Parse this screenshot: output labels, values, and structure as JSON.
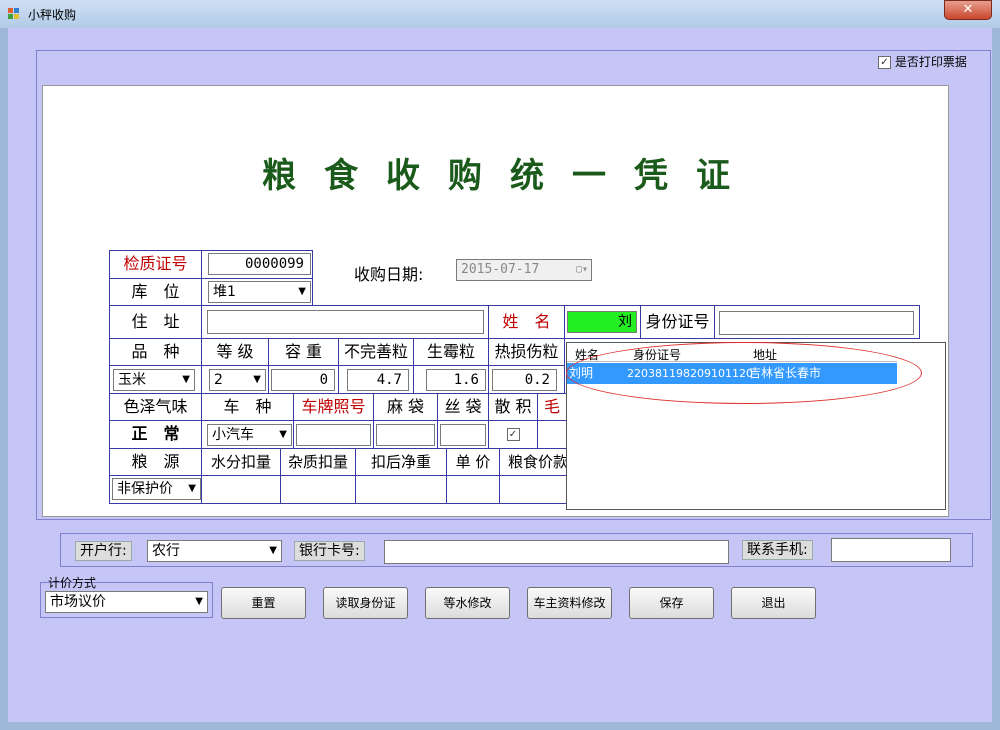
{
  "window": {
    "title": "小秤收购",
    "close_glyph": "✕"
  },
  "print_receipt": {
    "label": "是否打印票据",
    "checked": true
  },
  "voucher": {
    "title": "粮食收购统一凭证"
  },
  "form": {
    "inspection_no_label": "检质证号",
    "inspection_no": "0000099",
    "purchase_date_label": "收购日期:",
    "purchase_date": "2015-07-17",
    "warehouse_label": "库　位",
    "warehouse": "堆1",
    "address_label": "住　址",
    "address": "",
    "name_label": "姓　名",
    "name": "刘",
    "id_label": "身份证号",
    "id_no": "",
    "variety_label": "品　种",
    "variety": "玉米",
    "grade_label": "等 级",
    "grade": "2",
    "bulk_density_label": "容 重",
    "bulk_density": "0",
    "imperfect_label": "不完善粒",
    "imperfect": "4.7",
    "mold_label": "生霉粒",
    "mold": "1.6",
    "heat_damage_label": "热损伤粒",
    "heat_damage": "0.2",
    "color_smell_label": "色泽气味",
    "color_smell": "正　常",
    "vehicle_type_label": "车　种",
    "vehicle_type": "小汽车",
    "plate_label": "车牌照号",
    "sack_label": "麻 袋",
    "silk_bag_label": "丝 袋",
    "bulk_label": "散 积",
    "bulk_checked": true,
    "gross_label": "毛",
    "grain_source_label": "粮　源",
    "grain_source": "非保护价",
    "moisture_label": "水分扣量",
    "impurity_label": "杂质扣量",
    "net_weight_label": "扣后净重",
    "unit_price_label": "单 价",
    "grain_amount_label": "粮食价款"
  },
  "popup": {
    "columns": [
      "姓名",
      "身份证号",
      "地址"
    ],
    "rows": [
      {
        "name": "刘明",
        "id": "220381198209101120",
        "address": "吉林省长春市"
      }
    ]
  },
  "bank": {
    "bank_label": "开户行:",
    "bank": "农行",
    "card_label": "银行卡号:",
    "card": "",
    "phone_label": "联系手机:",
    "phone": ""
  },
  "pricing": {
    "legend": "计价方式",
    "method": "市场议价"
  },
  "buttons": {
    "reset": "重置",
    "read_id": "读取身份证",
    "water_edit": "等水修改",
    "owner_edit": "车主资料修改",
    "save": "保存",
    "exit": "退出"
  }
}
